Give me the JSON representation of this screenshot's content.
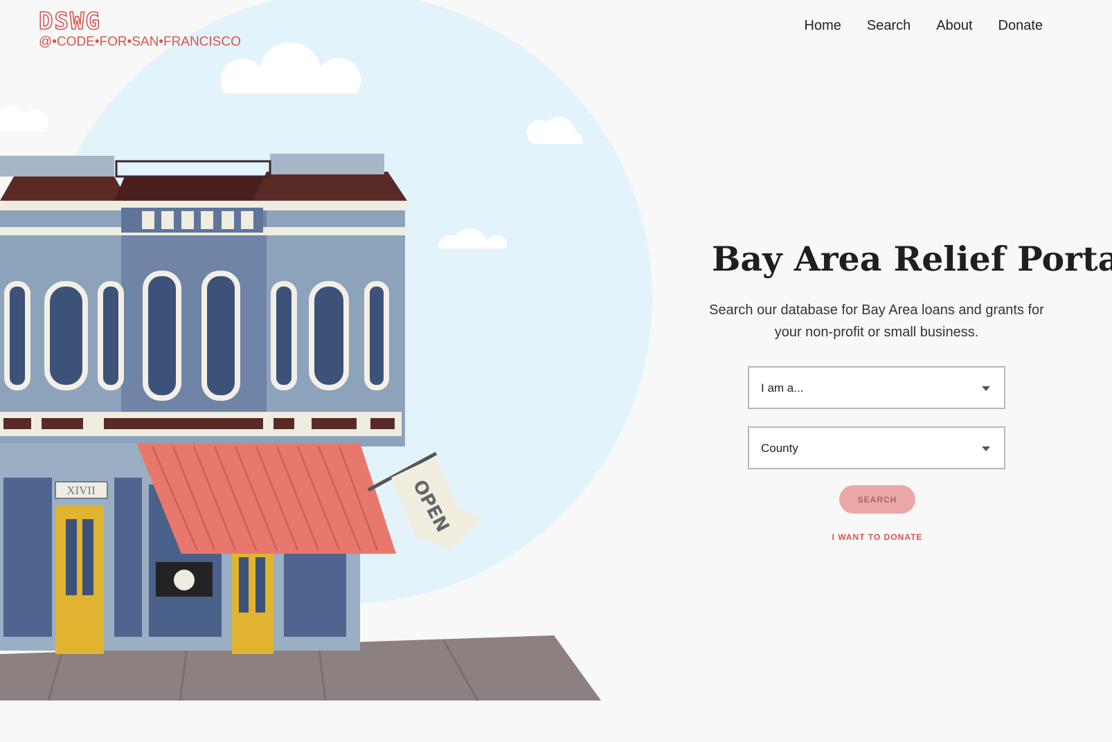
{
  "brand": {
    "mark": "DSWG",
    "tagline": "@•CODE•FOR•SAN•FRANCISCO"
  },
  "nav": {
    "items": [
      {
        "label": "Home"
      },
      {
        "label": "Search"
      },
      {
        "label": "About"
      },
      {
        "label": "Donate"
      }
    ]
  },
  "hero": {
    "title": "Bay Area Relief Portal",
    "subtitle_line1": "Search our database for Bay Area loans and grants for",
    "subtitle_line2": "your non-profit or small business."
  },
  "form": {
    "role_select": {
      "value": "I am a..."
    },
    "county_select": {
      "value": "County"
    },
    "search_button": "SEARCH",
    "donate_link": "I WANT TO DONATE"
  },
  "illustration": {
    "address_plaque": "XIVII",
    "flag_text": "OPEN"
  },
  "colors": {
    "accent": "#d9534f",
    "sky": "#e3f3fb",
    "awning": "#e8786e",
    "button": "#eba7a7"
  }
}
